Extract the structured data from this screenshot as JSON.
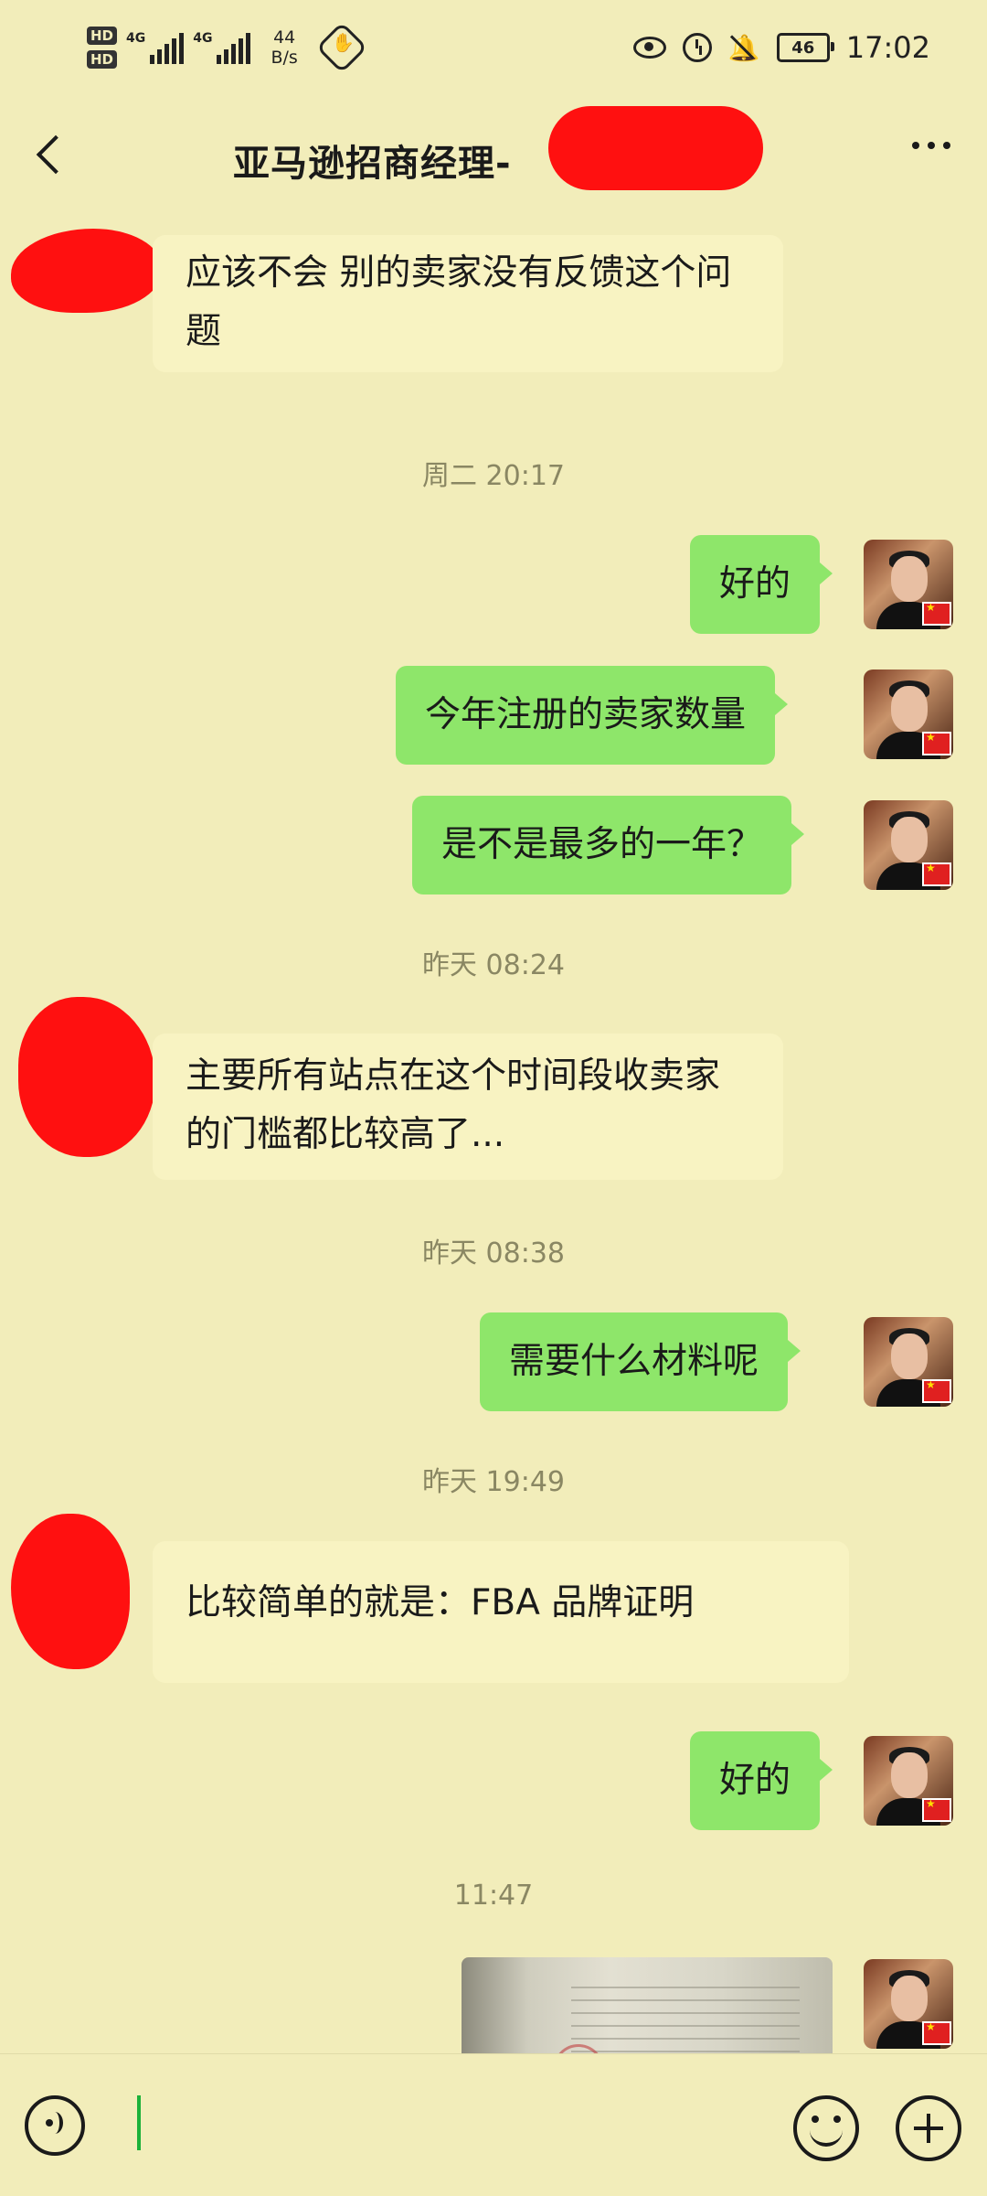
{
  "status_bar": {
    "hd1": "HD",
    "hd2": "HD",
    "net1": "4G",
    "net2": "4G",
    "speed_value": "44",
    "speed_unit": "B/s",
    "battery": "46",
    "time": "17:02",
    "icons": [
      "eye-icon",
      "alarm-icon",
      "mute-bell-icon",
      "battery-icon"
    ]
  },
  "header": {
    "title": "亚马逊招商经理-"
  },
  "messages": [
    {
      "side": "in",
      "text_line1": "应该不会 别的卖家没有反馈这个问",
      "text_line2": "题"
    },
    {
      "type": "time",
      "text": "周二 20:17"
    },
    {
      "side": "out",
      "text": "好的"
    },
    {
      "side": "out",
      "text": "今年注册的卖家数量"
    },
    {
      "side": "out",
      "text": "是不是最多的一年？"
    },
    {
      "type": "time",
      "text": "昨天 08:24"
    },
    {
      "side": "in",
      "text_line1": "主要所有站点在这个时间段收卖家",
      "text_line2": "的门槛都比较高了..."
    },
    {
      "type": "time",
      "text": "昨天 08:38"
    },
    {
      "side": "out",
      "text": "需要什么材料呢"
    },
    {
      "type": "time",
      "text": "昨天 19:49"
    },
    {
      "side": "in",
      "text": "比较简单的就是：FBA 品牌证明"
    },
    {
      "side": "out",
      "text": "好的"
    },
    {
      "type": "time",
      "text": "11:47"
    },
    {
      "side": "out",
      "type": "image"
    }
  ],
  "colors": {
    "background": "#f2edba",
    "outgoing_bubble": "#8ee66a",
    "incoming_bubble": "#f8f3c2",
    "redaction": "#ff1010",
    "caret": "#1cb23a"
  }
}
